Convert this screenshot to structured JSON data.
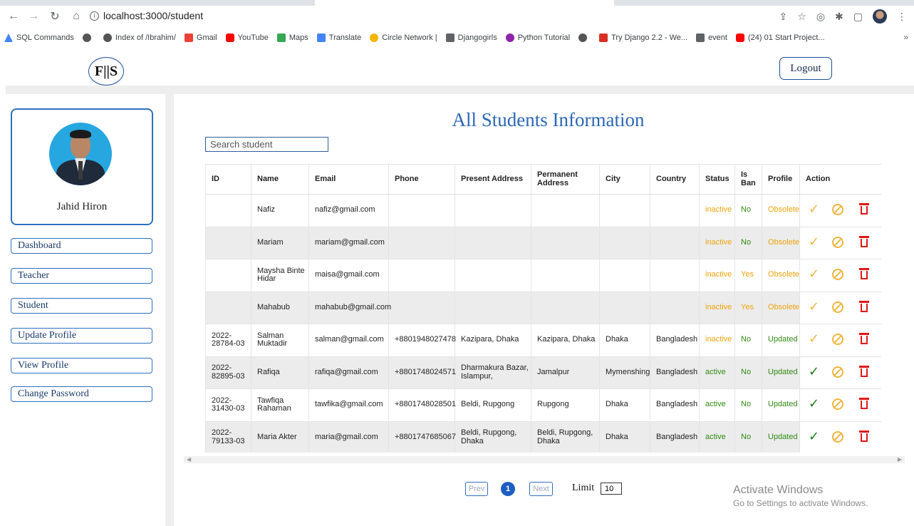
{
  "browser": {
    "url": "localhost:3000/student",
    "bookmarks": [
      "SQL Commands",
      "",
      "Index of /Ibrahim/",
      "Gmail",
      "YouTube",
      "Maps",
      "Translate",
      "Circle Network |",
      "Djangogirls",
      "Python Tutorial",
      "",
      "Try Django 2.2 - We...",
      "event",
      "(24) 01 Start Project..."
    ]
  },
  "header": {
    "logo": "F||S",
    "logout_label": "Logout"
  },
  "sidebar": {
    "user_name": "Jahid Hiron",
    "items": [
      {
        "label": "Dashboard"
      },
      {
        "label": "Teacher"
      },
      {
        "label": "Student"
      },
      {
        "label": "Update Profile"
      },
      {
        "label": "View Profile"
      },
      {
        "label": "Change Password"
      }
    ]
  },
  "main": {
    "title": "All Students Information",
    "search_placeholder": "Search student",
    "columns": [
      "ID",
      "Name",
      "Email",
      "Phone",
      "Present Address",
      "Permanent Address",
      "City",
      "Country",
      "Status",
      "Is Ban",
      "Profile",
      "Action"
    ],
    "rows": [
      {
        "id": "",
        "name": "Nafiz",
        "email": "nafiz@gmail.com",
        "phone": "",
        "present": "",
        "permanent": "",
        "city": "",
        "country": "",
        "status": "inactive",
        "ban": "No",
        "profile": "Obsolete",
        "approved": false
      },
      {
        "id": "",
        "name": "Mariam",
        "email": "mariam@gmail.com",
        "phone": "",
        "present": "",
        "permanent": "",
        "city": "",
        "country": "",
        "status": "inactive",
        "ban": "No",
        "profile": "Obsolete",
        "approved": false
      },
      {
        "id": "",
        "name": "Maysha Binte Hidar",
        "email": "maisa@gmail.com",
        "phone": "",
        "present": "",
        "permanent": "",
        "city": "",
        "country": "",
        "status": "inactive",
        "ban": "Yes",
        "profile": "Obsolete",
        "approved": false
      },
      {
        "id": "",
        "name": "Mahabub",
        "email": "mahabub@gmail.com",
        "phone": "",
        "present": "",
        "permanent": "",
        "city": "",
        "country": "",
        "status": "inactive",
        "ban": "Yes",
        "profile": "Obsolete",
        "approved": false
      },
      {
        "id": "2022-28784-03",
        "name": "Salman Muktadir",
        "email": "salman@gmail.com",
        "phone": "+8801948027478",
        "present": "Kazipara, Dhaka",
        "permanent": "Kazipara, Dhaka",
        "city": "Dhaka",
        "country": "Bangladesh",
        "status": "inactive",
        "ban": "No",
        "profile": "Updated",
        "approved": false
      },
      {
        "id": "2022-82895-03",
        "name": "Rafiqa",
        "email": "rafiqa@gmail.com",
        "phone": "+8801748024571",
        "present": "Dharmakura Bazar, Islampur,",
        "permanent": "Jamalpur",
        "city": "Mymenshing",
        "country": "Bangladesh",
        "status": "active",
        "ban": "No",
        "profile": "Updated",
        "approved": true
      },
      {
        "id": "2022-31430-03",
        "name": "Tawfiqa Rahaman",
        "email": "tawfika@gmail.com",
        "phone": "+8801748028501",
        "present": "Beldi, Rupgong",
        "permanent": "Rupgong",
        "city": "Dhaka",
        "country": "Bangladesh",
        "status": "active",
        "ban": "No",
        "profile": "Updated",
        "approved": true
      },
      {
        "id": "2022-79133-03",
        "name": "Maria Akter",
        "email": "maria@gmail.com",
        "phone": "+8801747685067",
        "present": "Beldi, Rupgong, Dhaka",
        "permanent": "Beldi, Rupgong, Dhaka",
        "city": "Dhaka",
        "country": "Bangladesh",
        "status": "active",
        "ban": "No",
        "profile": "Updated",
        "approved": true
      }
    ]
  },
  "pagination": {
    "prev": "Prev",
    "current": "1",
    "next": "Next",
    "limit_label": "Limit",
    "limit_value": "10"
  },
  "watermark": {
    "line1": "Activate Windows",
    "line2": "Go to Settings to activate Windows."
  }
}
